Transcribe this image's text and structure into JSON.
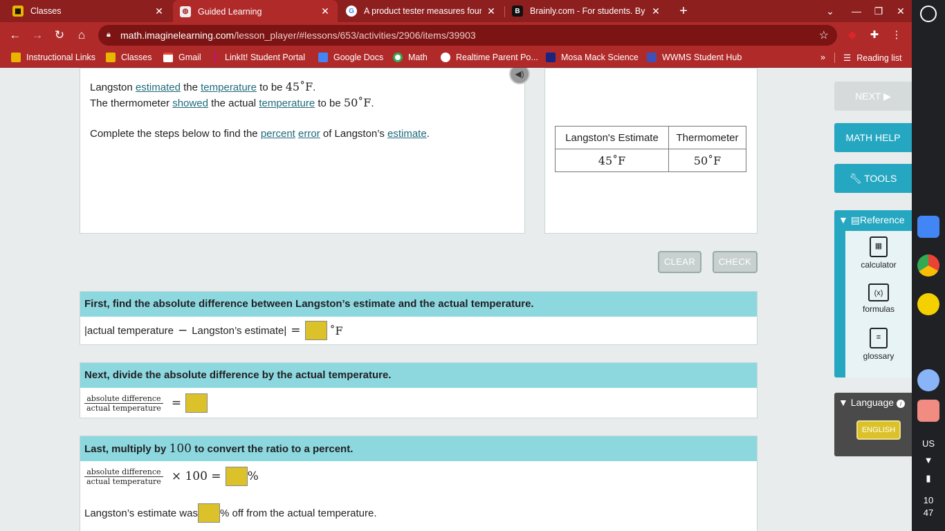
{
  "browser": {
    "tabs": [
      {
        "title": "Classes",
        "favicon_color": "#e8b600"
      },
      {
        "title": "Guided Learning",
        "favicon_color": "#e8e8e8"
      },
      {
        "title": "A product tester measures four c",
        "favicon_color": "#4285f4"
      },
      {
        "title": "Brainly.com - For students. By st",
        "favicon_color": "#000000"
      }
    ],
    "url_host": "math.imaginelearning.com",
    "url_path": "/lesson_player/#lessons/653/activities/2906/items/39903",
    "bookmarks": [
      {
        "label": "Instructional Links"
      },
      {
        "label": "Classes"
      },
      {
        "label": "Gmail"
      },
      {
        "label": "LinkIt! Student Portal"
      },
      {
        "label": "Google Docs"
      },
      {
        "label": "Math"
      },
      {
        "label": "Realtime Parent Po..."
      },
      {
        "label": "Mosa Mack Science"
      },
      {
        "label": "WWMS Student Hub"
      }
    ],
    "reading_list": "Reading list",
    "accent_color": "#b02a2a"
  },
  "prompt": {
    "line1_a": "Langston ",
    "line1_link1": "estimated",
    "line1_b": " the ",
    "line1_link2": "temperature",
    "line1_c": " to be ",
    "line1_value": "45˚F",
    "line1_end": ".",
    "line2_a": "The thermometer ",
    "line2_link1": "showed",
    "line2_b": " the actual ",
    "line2_link2": "temperature",
    "line2_c": " to be ",
    "line2_value": "50˚F",
    "line2_end": ".",
    "line3_a": "Complete the steps below to find the ",
    "line3_link1": "percent",
    "line3_link2": "error",
    "line3_b": " of Langston’s ",
    "line3_link3": "estimate",
    "line3_end": "."
  },
  "data_table": {
    "headers": [
      "Langston's Estimate",
      "Thermometer"
    ],
    "values": [
      "45˚F",
      "50˚F"
    ]
  },
  "actions": {
    "clear": "CLEAR",
    "check": "CHECK"
  },
  "steps": [
    {
      "heading": "First, find the absolute difference between Langston’s estimate and the actual temperature.",
      "expr_left": "|actual temperature",
      "minus": "−",
      "expr_right": "Langston’s estimate|",
      "equals": "=",
      "unit": "˚F"
    },
    {
      "heading": "Next, divide the absolute difference by the actual temperature.",
      "frac_num": "absolute difference",
      "frac_den": "actual temperature",
      "equals": "="
    },
    {
      "heading_a": "Last, multiply by ",
      "heading_num": "100",
      "heading_b": " to convert the ratio to a percent.",
      "frac_num": "absolute difference",
      "frac_den": "actual temperature",
      "times": "× 100 =",
      "unit": "%",
      "sentence_a": "Langston’s estimate was ",
      "sentence_b": "% off from the actual temperature."
    }
  ],
  "sidebar": {
    "next": "NEXT ▶",
    "math_help": "MATH HELP",
    "tools": "TOOLS",
    "reference": "Reference",
    "ref_items": [
      "calculator",
      "formulas",
      "glossary"
    ],
    "language": "Language",
    "english": "ENGLISH"
  },
  "shelf": {
    "locale": "US",
    "hour": "10",
    "minute": "47"
  }
}
